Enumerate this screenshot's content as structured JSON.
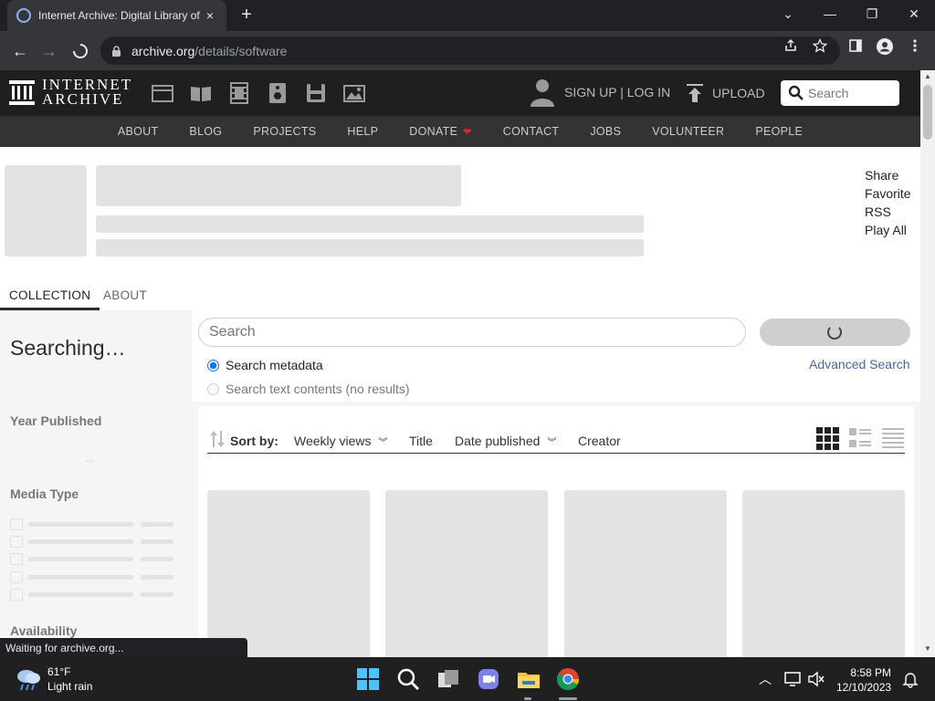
{
  "browser": {
    "tab_title": "Internet Archive: Digital Library of Free & Borrowable Books, Movies, Music & Wayback Machine",
    "tab_close": "×",
    "new_tab": "+",
    "url_host": "archive.org",
    "url_path": "/details/software",
    "back": "←",
    "forward": "→",
    "minimize": "—",
    "restore": "❐",
    "close": "✕",
    "tab_list": "⌄"
  },
  "site": {
    "logo_line1": "INTERNET",
    "logo_line2": "ARCHIVE",
    "signup_login": "SIGN UP | LOG IN",
    "upload": "UPLOAD",
    "search_placeholder": "Search",
    "nav": [
      {
        "label": "ABOUT"
      },
      {
        "label": "BLOG"
      },
      {
        "label": "PROJECTS"
      },
      {
        "label": "HELP"
      },
      {
        "label": "DONATE"
      },
      {
        "label": "CONTACT"
      },
      {
        "label": "JOBS"
      },
      {
        "label": "VOLUNTEER"
      },
      {
        "label": "PEOPLE"
      }
    ],
    "heart_color": "#e0262c"
  },
  "collection": {
    "side_links": [
      "Share",
      "Favorite",
      "RSS",
      "Play All"
    ],
    "tabs": [
      "COLLECTION",
      "ABOUT"
    ]
  },
  "facets": {
    "searching": "Searching…",
    "dots": "...",
    "year_published": "Year Published",
    "media_type": "Media Type",
    "availability": "Availability"
  },
  "search": {
    "placeholder": "Search",
    "metadata_option": "Search metadata",
    "text_option": "Search text contents (no results)",
    "advanced": "Advanced Search"
  },
  "sort": {
    "label": "Sort by:",
    "options": [
      "Weekly views",
      "Title",
      "Date published",
      "Creator"
    ]
  },
  "status_text": "Waiting for archive.org...",
  "taskbar": {
    "temp": "61°F",
    "condition": "Light rain",
    "time": "8:58 PM",
    "date": "12/10/2023"
  }
}
